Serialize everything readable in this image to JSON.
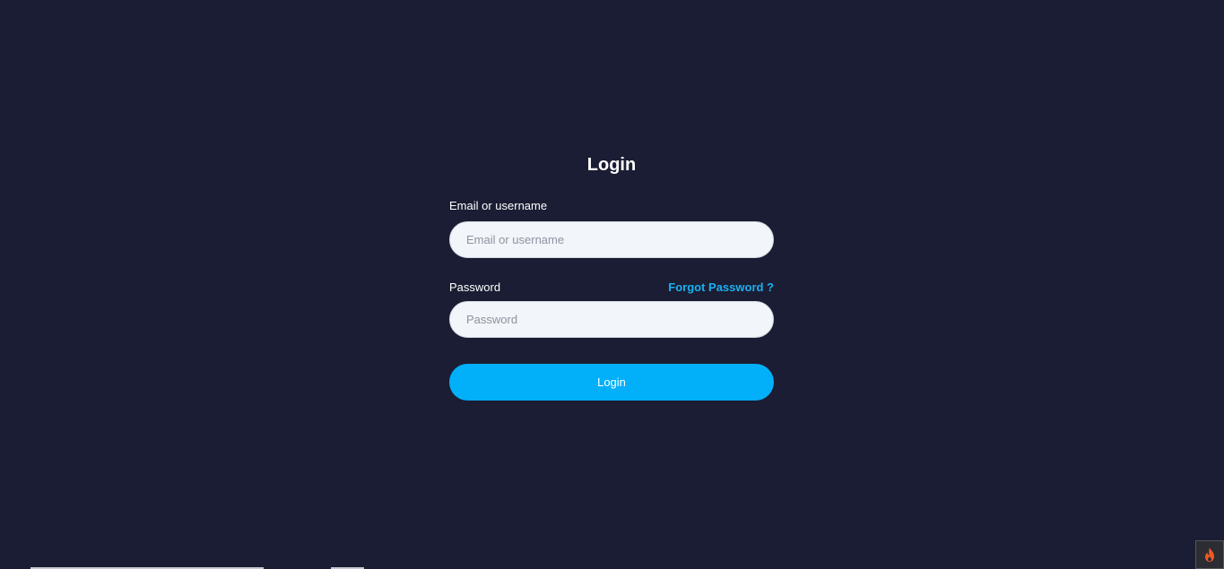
{
  "login": {
    "title": "Login",
    "email_label": "Email or username",
    "email_placeholder": "Email or username",
    "email_value": "",
    "password_label": "Password",
    "password_placeholder": "Password",
    "password_value": "",
    "forgot_link": "Forgot Password ?",
    "submit_label": "Login"
  },
  "corner_widget": {
    "icon": "flame-icon"
  },
  "colors": {
    "background": "#1a1d33",
    "accent": "#02b0fa",
    "link": "#1ab0f0",
    "field_bg": "#f2f5f9"
  }
}
